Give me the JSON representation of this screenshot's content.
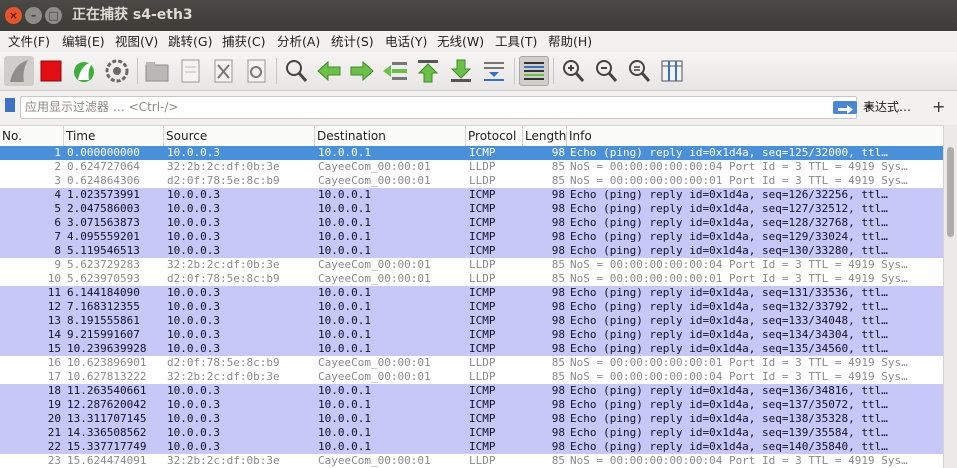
{
  "window": {
    "title": "正在捕获 s4-eth3"
  },
  "menu": [
    "文件(F)",
    "编辑(E)",
    "视图(V)",
    "跳转(G)",
    "捕获(C)",
    "分析(A)",
    "统计(S)",
    "电话(Y)",
    "无线(W)",
    "工具(T)",
    "帮助(H)"
  ],
  "toolbar": {
    "icons": [
      "shark-fin-icon",
      "stop-icon",
      "restart-icon",
      "options-gear-icon",
      "open-folder-icon",
      "save-file-icon",
      "close-file-icon",
      "reload-icon",
      "find-icon",
      "back-arrow-icon",
      "forward-arrow-icon",
      "go-to-packet-icon",
      "first-packet-icon",
      "last-packet-icon",
      "autoscroll-icon",
      "colorize-icon",
      "zoom-in-icon",
      "zoom-out-icon",
      "zoom-normal-icon",
      "resize-columns-icon"
    ]
  },
  "filter": {
    "placeholder": "应用显示过滤器 … <Ctrl-/>",
    "expression_label": "表达式…",
    "plus_label": "+"
  },
  "columns": [
    "No.",
    "Time",
    "Source",
    "Destination",
    "Protocol",
    "Length",
    "Info"
  ],
  "colors": {
    "selected": "#4a90d9",
    "icmp": "#c7c7f8",
    "lldp": "#ffffff",
    "lldp_text": "#8a8a8a"
  },
  "packets": [
    {
      "no": "1",
      "time": "0.000000000",
      "src": "10.0.0.3",
      "dst": "10.0.0.1",
      "proto": "ICMP",
      "len": "98",
      "info": "Echo (ping) reply    id=0x1d4a, seq=125/32000, ttl…",
      "type": "selected"
    },
    {
      "no": "2",
      "time": "0.624727064",
      "src": "32:2b:2c:df:0b:3e",
      "dst": "CayeeCom_00:00:01",
      "proto": "LLDP",
      "len": "85",
      "info": "NoS = 00:00:00:00:00:04 Port Id = 3 TTL = 4919 Sys…",
      "type": "lldp"
    },
    {
      "no": "3",
      "time": "0.624864306",
      "src": "d2:0f:78:5e:8c:b9",
      "dst": "CayeeCom_00:00:01",
      "proto": "LLDP",
      "len": "85",
      "info": "NoS = 00:00:00:00:00:01 Port Id = 3 TTL = 4919 Sys…",
      "type": "lldp"
    },
    {
      "no": "4",
      "time": "1.023573991",
      "src": "10.0.0.3",
      "dst": "10.0.0.1",
      "proto": "ICMP",
      "len": "98",
      "info": "Echo (ping) reply    id=0x1d4a, seq=126/32256, ttl…",
      "type": "icmp"
    },
    {
      "no": "5",
      "time": "2.047586003",
      "src": "10.0.0.3",
      "dst": "10.0.0.1",
      "proto": "ICMP",
      "len": "98",
      "info": "Echo (ping) reply    id=0x1d4a, seq=127/32512, ttl…",
      "type": "icmp"
    },
    {
      "no": "6",
      "time": "3.071563873",
      "src": "10.0.0.3",
      "dst": "10.0.0.1",
      "proto": "ICMP",
      "len": "98",
      "info": "Echo (ping) reply    id=0x1d4a, seq=128/32768, ttl…",
      "type": "icmp"
    },
    {
      "no": "7",
      "time": "4.095559201",
      "src": "10.0.0.3",
      "dst": "10.0.0.1",
      "proto": "ICMP",
      "len": "98",
      "info": "Echo (ping) reply    id=0x1d4a, seq=129/33024, ttl…",
      "type": "icmp"
    },
    {
      "no": "8",
      "time": "5.119546513",
      "src": "10.0.0.3",
      "dst": "10.0.0.1",
      "proto": "ICMP",
      "len": "98",
      "info": "Echo (ping) reply    id=0x1d4a, seq=130/33280, ttl…",
      "type": "icmp"
    },
    {
      "no": "9",
      "time": "5.623729283",
      "src": "32:2b:2c:df:0b:3e",
      "dst": "CayeeCom_00:00:01",
      "proto": "LLDP",
      "len": "85",
      "info": "NoS = 00:00:00:00:00:04 Port Id = 3 TTL = 4919 Sys…",
      "type": "lldp"
    },
    {
      "no": "10",
      "time": "5.623970593",
      "src": "d2:0f:78:5e:8c:b9",
      "dst": "CayeeCom_00:00:01",
      "proto": "LLDP",
      "len": "85",
      "info": "NoS = 00:00:00:00:00:01 Port Id = 3 TTL = 4919 Sys…",
      "type": "lldp"
    },
    {
      "no": "11",
      "time": "6.144184090",
      "src": "10.0.0.3",
      "dst": "10.0.0.1",
      "proto": "ICMP",
      "len": "98",
      "info": "Echo (ping) reply    id=0x1d4a, seq=131/33536, ttl…",
      "type": "icmp"
    },
    {
      "no": "12",
      "time": "7.168312355",
      "src": "10.0.0.3",
      "dst": "10.0.0.1",
      "proto": "ICMP",
      "len": "98",
      "info": "Echo (ping) reply    id=0x1d4a, seq=132/33792, ttl…",
      "type": "icmp"
    },
    {
      "no": "13",
      "time": "8.191555861",
      "src": "10.0.0.3",
      "dst": "10.0.0.1",
      "proto": "ICMP",
      "len": "98",
      "info": "Echo (ping) reply    id=0x1d4a, seq=133/34048, ttl…",
      "type": "icmp"
    },
    {
      "no": "14",
      "time": "9.215991607",
      "src": "10.0.0.3",
      "dst": "10.0.0.1",
      "proto": "ICMP",
      "len": "98",
      "info": "Echo (ping) reply    id=0x1d4a, seq=134/34304, ttl…",
      "type": "icmp"
    },
    {
      "no": "15",
      "time": "10.239639928",
      "src": "10.0.0.3",
      "dst": "10.0.0.1",
      "proto": "ICMP",
      "len": "98",
      "info": "Echo (ping) reply    id=0x1d4a, seq=135/34560, ttl…",
      "type": "icmp"
    },
    {
      "no": "16",
      "time": "10.623896901",
      "src": "d2:0f:78:5e:8c:b9",
      "dst": "CayeeCom_00:00:01",
      "proto": "LLDP",
      "len": "85",
      "info": "NoS = 00:00:00:00:00:01 Port Id = 3 TTL = 4919 Sys…",
      "type": "lldp"
    },
    {
      "no": "17",
      "time": "10.627813222",
      "src": "32:2b:2c:df:0b:3e",
      "dst": "CayeeCom_00:00:01",
      "proto": "LLDP",
      "len": "85",
      "info": "NoS = 00:00:00:00:00:04 Port Id = 3 TTL = 4919 Sys…",
      "type": "lldp"
    },
    {
      "no": "18",
      "time": "11.263540661",
      "src": "10.0.0.3",
      "dst": "10.0.0.1",
      "proto": "ICMP",
      "len": "98",
      "info": "Echo (ping) reply    id=0x1d4a, seq=136/34816, ttl…",
      "type": "icmp"
    },
    {
      "no": "19",
      "time": "12.287620042",
      "src": "10.0.0.3",
      "dst": "10.0.0.1",
      "proto": "ICMP",
      "len": "98",
      "info": "Echo (ping) reply    id=0x1d4a, seq=137/35072, ttl…",
      "type": "icmp"
    },
    {
      "no": "20",
      "time": "13.311707145",
      "src": "10.0.0.3",
      "dst": "10.0.0.1",
      "proto": "ICMP",
      "len": "98",
      "info": "Echo (ping) reply    id=0x1d4a, seq=138/35328, ttl…",
      "type": "icmp"
    },
    {
      "no": "21",
      "time": "14.336508562",
      "src": "10.0.0.3",
      "dst": "10.0.0.1",
      "proto": "ICMP",
      "len": "98",
      "info": "Echo (ping) reply    id=0x1d4a, seq=139/35584, ttl…",
      "type": "icmp"
    },
    {
      "no": "22",
      "time": "15.337717749",
      "src": "10.0.0.3",
      "dst": "10.0.0.1",
      "proto": "ICMP",
      "len": "98",
      "info": "Echo (ping) reply    id=0x1d4a, seq=140/35840, ttl…",
      "type": "icmp"
    },
    {
      "no": "23",
      "time": "15.624474091",
      "src": "32:2b:2c:df:0b:3e",
      "dst": "CayeeCom_00:00:01",
      "proto": "LLDP",
      "len": "85",
      "info": "NoS = 00:00:00:00:00:04 Port Id = 3 TTL = 4919 Sys…",
      "type": "lldp"
    }
  ]
}
